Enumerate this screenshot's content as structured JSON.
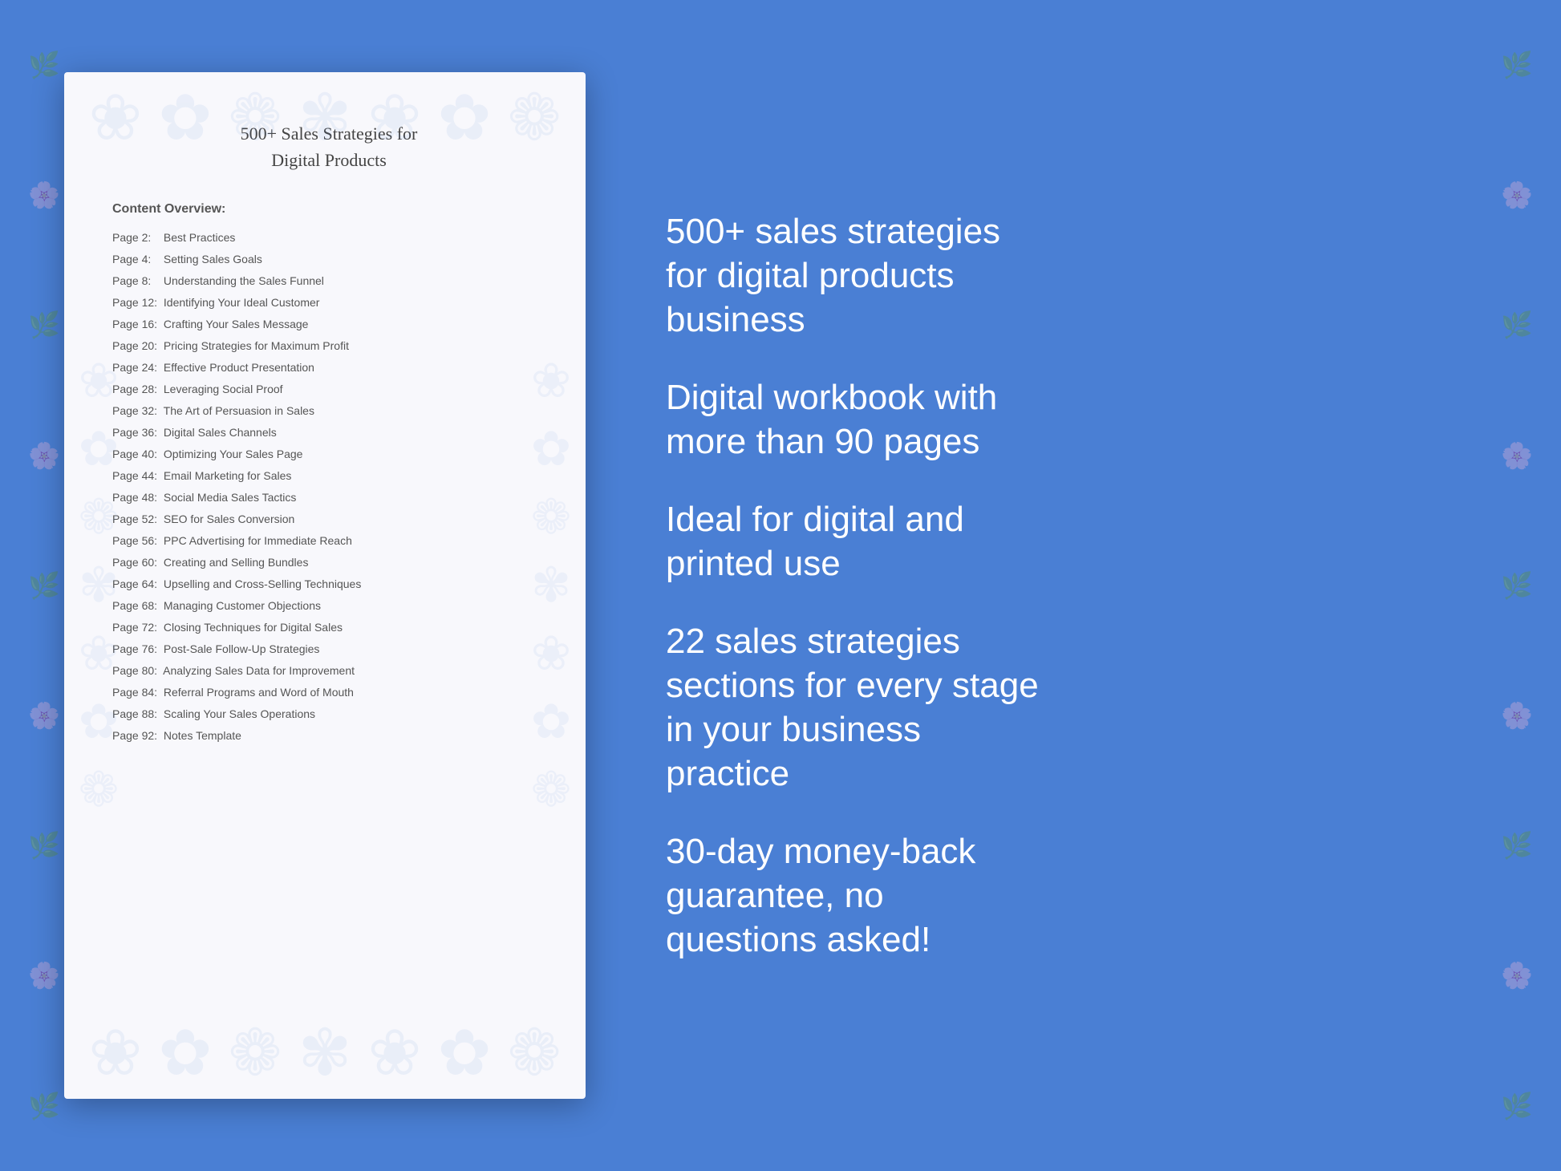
{
  "background": {
    "color": "#4a7fd4"
  },
  "document": {
    "title_line1": "500+ Sales Strategies for",
    "title_line2": "Digital Products",
    "section_heading": "Content Overview:",
    "toc_items": [
      {
        "page": "Page  2:",
        "title": "Best Practices"
      },
      {
        "page": "Page  4:",
        "title": "Setting Sales Goals"
      },
      {
        "page": "Page  8:",
        "title": "Understanding the Sales Funnel"
      },
      {
        "page": "Page 12:",
        "title": "Identifying Your Ideal Customer"
      },
      {
        "page": "Page 16:",
        "title": "Crafting Your Sales Message"
      },
      {
        "page": "Page 20:",
        "title": "Pricing Strategies for Maximum Profit"
      },
      {
        "page": "Page 24:",
        "title": "Effective Product Presentation"
      },
      {
        "page": "Page 28:",
        "title": "Leveraging Social Proof"
      },
      {
        "page": "Page 32:",
        "title": "The Art of Persuasion in Sales"
      },
      {
        "page": "Page 36:",
        "title": "Digital Sales Channels"
      },
      {
        "page": "Page 40:",
        "title": "Optimizing Your Sales Page"
      },
      {
        "page": "Page 44:",
        "title": "Email Marketing for Sales"
      },
      {
        "page": "Page 48:",
        "title": "Social Media Sales Tactics"
      },
      {
        "page": "Page 52:",
        "title": "SEO for Sales Conversion"
      },
      {
        "page": "Page 56:",
        "title": "PPC Advertising for Immediate Reach"
      },
      {
        "page": "Page 60:",
        "title": "Creating and Selling Bundles"
      },
      {
        "page": "Page 64:",
        "title": "Upselling and Cross-Selling Techniques"
      },
      {
        "page": "Page 68:",
        "title": "Managing Customer Objections"
      },
      {
        "page": "Page 72:",
        "title": "Closing Techniques for Digital Sales"
      },
      {
        "page": "Page 76:",
        "title": "Post-Sale Follow-Up Strategies"
      },
      {
        "page": "Page 80:",
        "title": "Analyzing Sales Data for Improvement"
      },
      {
        "page": "Page 84:",
        "title": "Referral Programs and Word of Mouth"
      },
      {
        "page": "Page 88:",
        "title": "Scaling Your Sales Operations"
      },
      {
        "page": "Page 92:",
        "title": "Notes Template"
      }
    ]
  },
  "features": [
    "500+ sales strategies\nfor digital products\nbusiness",
    "Digital workbook with\nmore than 90 pages",
    "Ideal for digital and\nprinted use",
    "22 sales strategies\nsections for every stage\nin your business\npractice",
    "30-day money-back\nguarantee, no\nquestions asked!"
  ],
  "floral_symbols": [
    "❀",
    "✿",
    "❁",
    "✾",
    "❀",
    "✿",
    "❁",
    "✾",
    "❀",
    "✿",
    "❁",
    "✾"
  ]
}
